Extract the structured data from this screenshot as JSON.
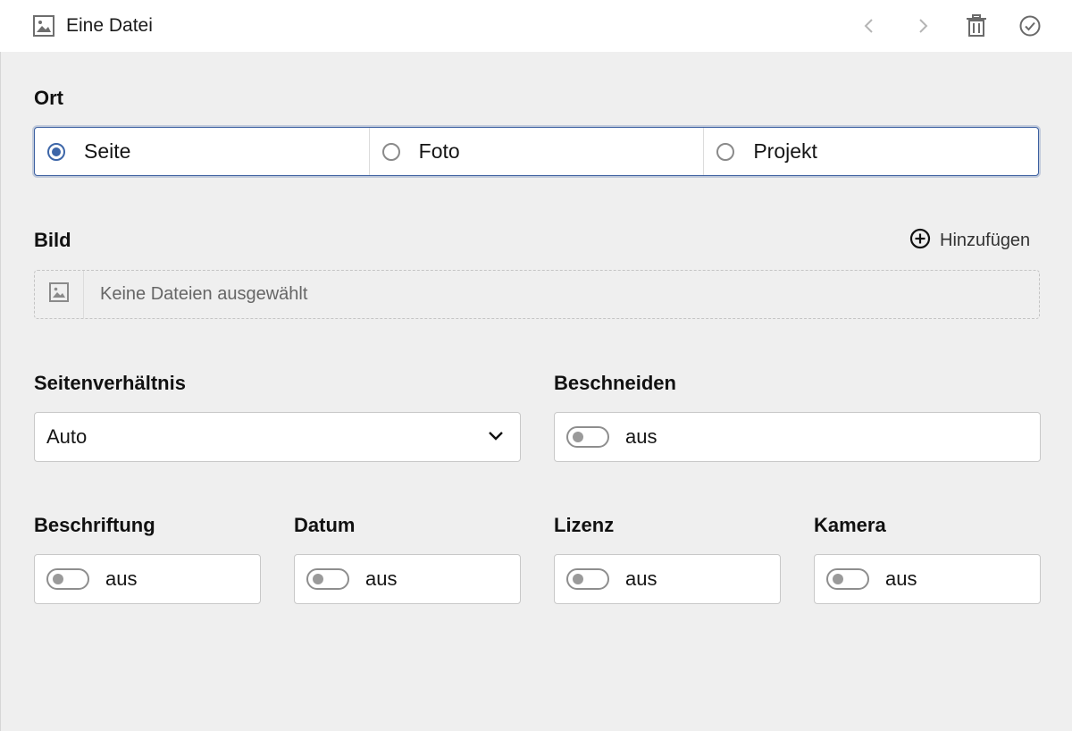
{
  "header": {
    "title": "Eine Datei",
    "icons": [
      "image-icon",
      "chevron-left-icon",
      "chevron-right-icon",
      "trash-icon",
      "check-circle-icon"
    ]
  },
  "ort": {
    "label": "Ort",
    "options": [
      {
        "label": "Seite",
        "checked": true
      },
      {
        "label": "Foto",
        "checked": false
      },
      {
        "label": "Projekt",
        "checked": false
      }
    ]
  },
  "bild": {
    "label": "Bild",
    "add_label": "Hinzufügen",
    "empty_text": "Keine Dateien ausgewählt"
  },
  "seitenverhaeltnis": {
    "label": "Seitenverhältnis",
    "value": "Auto"
  },
  "beschneiden": {
    "label": "Beschneiden",
    "value": "aus"
  },
  "beschriftung": {
    "label": "Beschriftung",
    "value": "aus"
  },
  "datum": {
    "label": "Datum",
    "value": "aus"
  },
  "lizenz": {
    "label": "Lizenz",
    "value": "aus"
  },
  "kamera": {
    "label": "Kamera",
    "value": "aus"
  },
  "colors": {
    "accent": "#d4b12a",
    "focus": "#3b5fa0",
    "radio_checked": "#3d66a8",
    "background": "#efefef"
  }
}
